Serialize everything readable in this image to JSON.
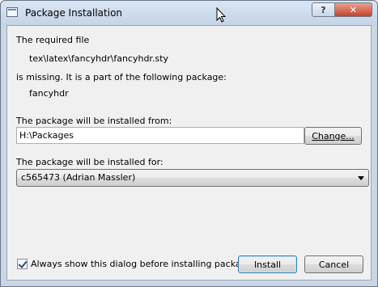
{
  "window": {
    "title": "Package Installation",
    "help_label": "?",
    "close_label": "✕"
  },
  "dialog": {
    "required_file_label": "The required file",
    "file_path": "tex\\latex\\fancyhdr\\fancyhdr.sty",
    "missing_text": "is missing. It is a part of the following package:",
    "package_name": "fancyhdr",
    "install_from_label": "The package will be installed from:",
    "install_from_value": "H:\\Packages",
    "change_button": "Change...",
    "install_for_label": "The package will be installed for:",
    "install_for_value": "c565473 (Adrian Massler)",
    "always_show_checkbox_label": "Always show this dialog before installing packages",
    "always_show_checked": true,
    "install_button": "Install",
    "cancel_button": "Cancel"
  }
}
